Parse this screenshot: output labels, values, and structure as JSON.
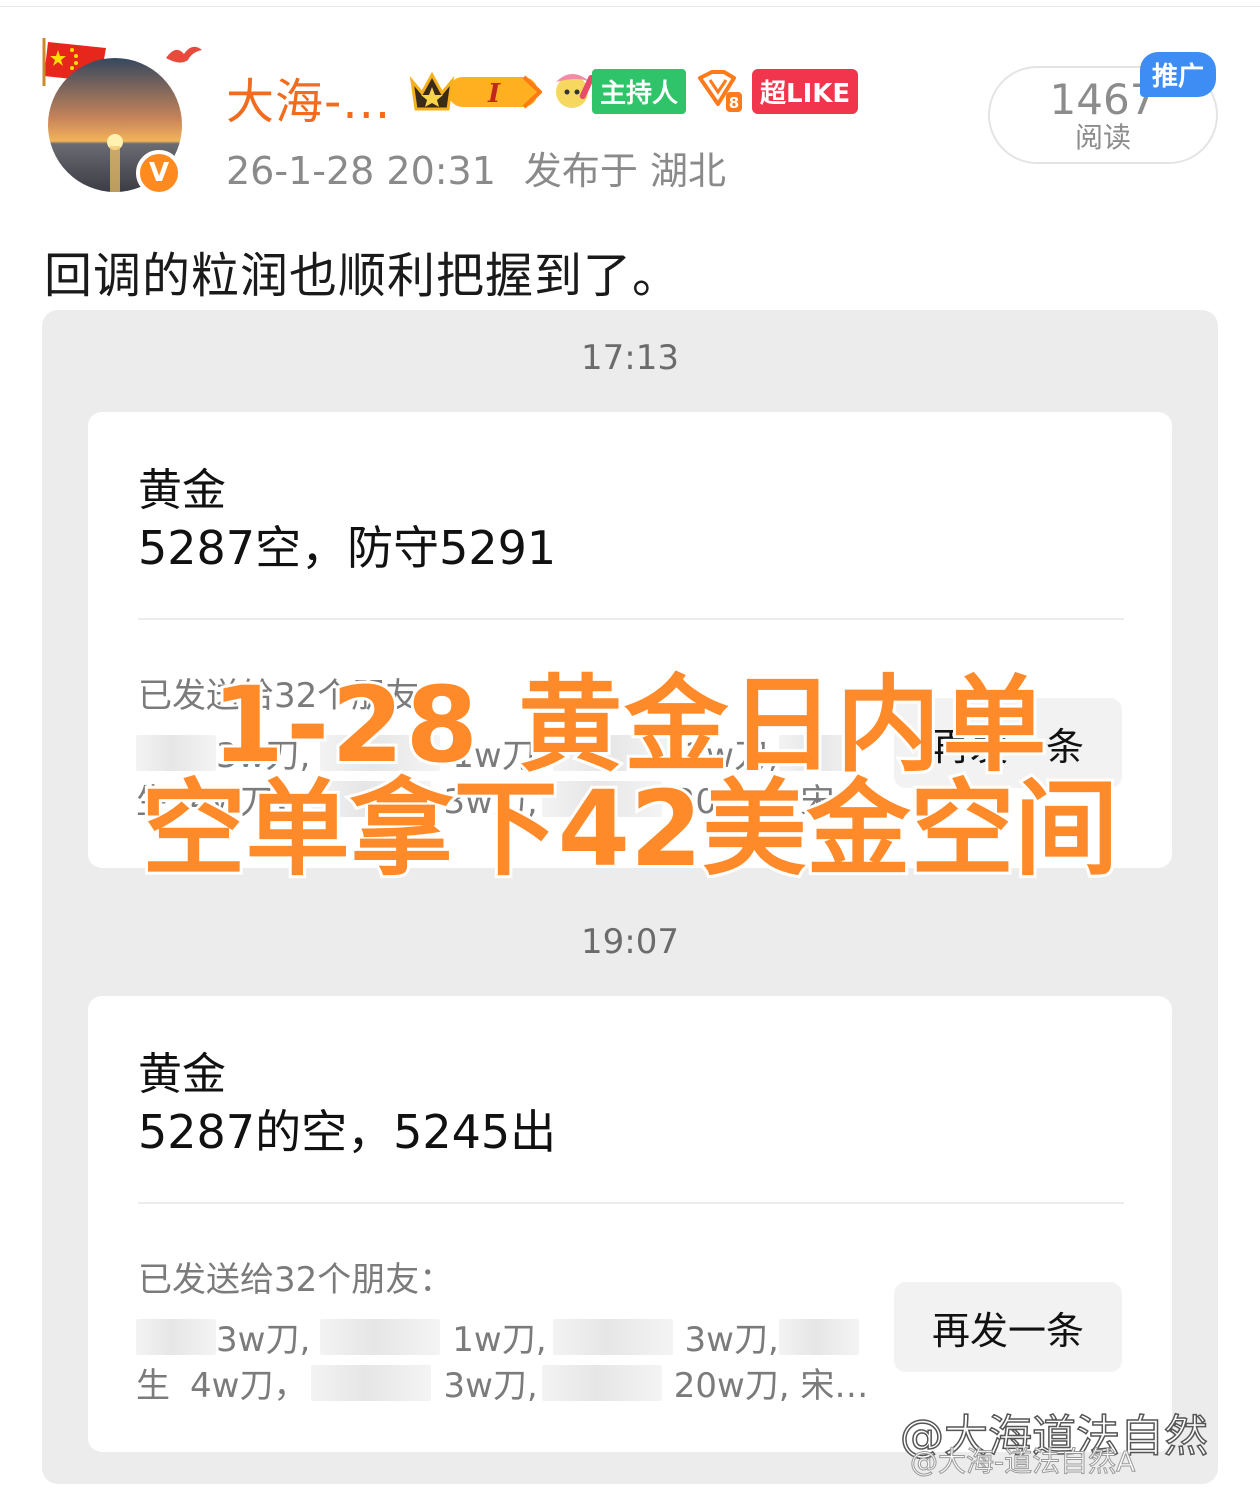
{
  "author": {
    "name": "大海-...",
    "verified_mark": "V",
    "badges": {
      "host_label": "主持人",
      "like_label": "超LIKE",
      "crown_level": "I"
    }
  },
  "post": {
    "timestamp": "26-1-28 20:31",
    "location": "发布于 湖北",
    "text": "回调的粒润也顺利把握到了。"
  },
  "read": {
    "count": "1467",
    "label": "阅读",
    "promo_tag": "推广"
  },
  "messages": [
    {
      "time": "17:13",
      "title": "黄金",
      "body": "5287空，防守5291",
      "sent_label": "已发送给32个朋友：",
      "line1": [
        "3w刀,",
        "1w刀,",
        "3w刀,"
      ],
      "line2": [
        "生",
        "4w刀，",
        "3w刀,",
        "20w刀, 宋…"
      ],
      "resend": "再发一条"
    },
    {
      "time": "19:07",
      "title": "黄金",
      "body": "5287的空，5245出",
      "sent_label": "已发送给32个朋友：",
      "line1": [
        "3w刀,",
        "1w刀,",
        "3w刀,"
      ],
      "line2": [
        "生",
        "4w刀，",
        "3w刀,",
        "20w刀, 宋…"
      ],
      "resend": "再发一条"
    }
  ],
  "overlay": {
    "line1": "1-28 黄金日内单",
    "line2": "空单拿下42美金空间"
  },
  "watermark": {
    "main": "@大海道法自然",
    "sub": "@大海-道法自然A"
  },
  "colors": {
    "username": "#f36b1c",
    "overlay_fill": "#ff8a2a",
    "host_badge": "#2fc46a",
    "like_badge": "#f0354c",
    "promo": "#3d8df5"
  }
}
